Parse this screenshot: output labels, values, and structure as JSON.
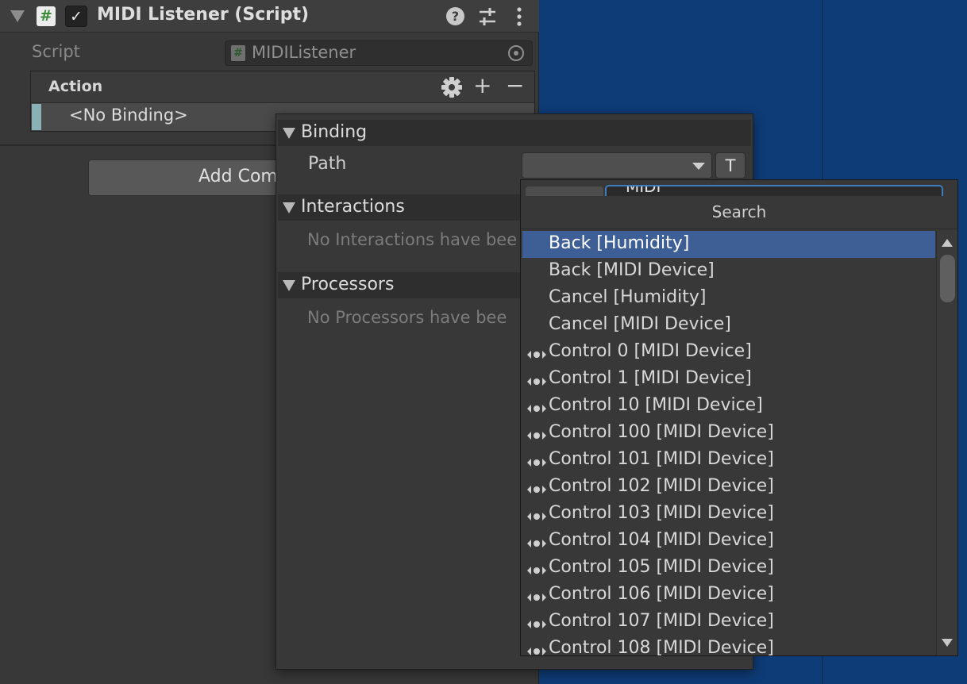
{
  "inspector": {
    "component": {
      "title": "MIDI Listener (Script)",
      "enabled_checkmark": "✓",
      "icon": "csharp-script-icon",
      "help_glyph": "?"
    },
    "script": {
      "label": "Script",
      "value": "MIDIListener"
    },
    "action": {
      "header": "Action",
      "plus_glyph": "+",
      "minus_glyph": "−",
      "binding": "<No Binding>"
    },
    "add_component": "Add Com"
  },
  "binding_popup": {
    "binding_section": "Binding",
    "path_label": "Path",
    "t_button": "T",
    "interactions_section": "Interactions",
    "no_interactions": "No Interactions have bee",
    "processors_section": "Processors",
    "no_processors": "No Processors have bee"
  },
  "search_popup": {
    "search_text": "MIDI",
    "title": "Search",
    "results": [
      {
        "label": "Back [Humidity]",
        "icon": "",
        "selected": true
      },
      {
        "label": "Back [MIDI Device]",
        "icon": "",
        "selected": false
      },
      {
        "label": "Cancel [Humidity]",
        "icon": "",
        "selected": false
      },
      {
        "label": "Cancel [MIDI Device]",
        "icon": "",
        "selected": false
      },
      {
        "label": "Control 0 [MIDI Device]",
        "icon": "axis-icon",
        "selected": false
      },
      {
        "label": "Control 1 [MIDI Device]",
        "icon": "axis-icon",
        "selected": false
      },
      {
        "label": "Control 10 [MIDI Device]",
        "icon": "axis-icon",
        "selected": false
      },
      {
        "label": "Control 100 [MIDI Device]",
        "icon": "axis-icon",
        "selected": false
      },
      {
        "label": "Control 101 [MIDI Device]",
        "icon": "axis-icon",
        "selected": false
      },
      {
        "label": "Control 102 [MIDI Device]",
        "icon": "axis-icon",
        "selected": false
      },
      {
        "label": "Control 103 [MIDI Device]",
        "icon": "axis-icon",
        "selected": false
      },
      {
        "label": "Control 104 [MIDI Device]",
        "icon": "axis-icon",
        "selected": false
      },
      {
        "label": "Control 105 [MIDI Device]",
        "icon": "axis-icon",
        "selected": false
      },
      {
        "label": "Control 106 [MIDI Device]",
        "icon": "axis-icon",
        "selected": false
      },
      {
        "label": "Control 107 [MIDI Device]",
        "icon": "axis-icon",
        "selected": false
      },
      {
        "label": "Control 108 [MIDI Device]",
        "icon": "axis-icon",
        "selected": false
      }
    ]
  },
  "colors": {
    "scene_background": "#0e3c77",
    "selection": "#3e5f96",
    "binding_stripe": "#8ab1b6",
    "search_focus": "#3f7bbf"
  }
}
